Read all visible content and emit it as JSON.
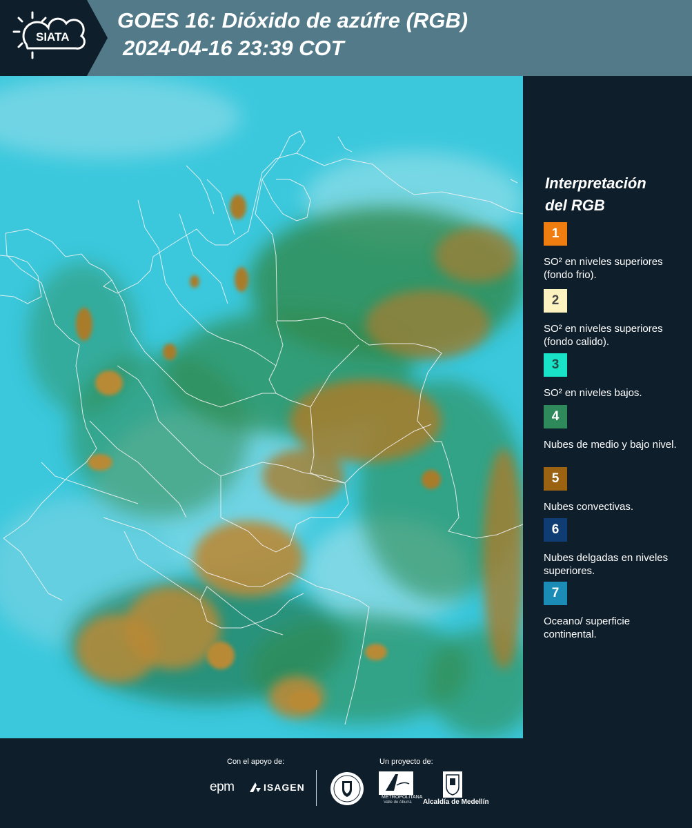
{
  "header": {
    "logo_text": "SIATA",
    "title_line1": "GOES 16: Dióxido de azúfre (RGB)",
    "title_line2": "2024-04-16 23:39 COT"
  },
  "legend": {
    "title_line1": "Interpretación",
    "title_line2": "del RGB",
    "items": [
      {
        "number": "1",
        "color": "#f07d0f",
        "text_color": "#ffffff",
        "text": "SO² en niveles superiores (fondo frio)."
      },
      {
        "number": "2",
        "color": "#fdf3c0",
        "text_color": "#444444",
        "text": "SO² en niveles superiores (fondo calido)."
      },
      {
        "number": "3",
        "color": "#18e3c6",
        "text_color": "#1f4e4a",
        "text": "SO² en niveles bajos."
      },
      {
        "number": "4",
        "color": "#2f8a5b",
        "text_color": "#ffffff",
        "text": "Nubes de medio y bajo nivel."
      },
      {
        "number": "5",
        "color": "#9a6211",
        "text_color": "#ffffff",
        "text": "Nubes convectivas."
      },
      {
        "number": "6",
        "color": "#103c74",
        "text_color": "#ffffff",
        "text": "Nubes delgadas en niveles superiores."
      },
      {
        "number": "7",
        "color": "#1b8cb5",
        "text_color": "#ffffff",
        "text": "Oceano/ superficie continental."
      }
    ]
  },
  "footer": {
    "support_label": "Con el apoyo de:",
    "project_label": "Un proyecto de:",
    "sponsors": [
      "epm",
      "ISAGEN"
    ],
    "partners": [
      "Área Metropolitana Valle de Aburrá",
      "Alcaldía de Medellín"
    ],
    "area_text_1": "METROPOLITANA",
    "area_text_2": "Valle de Aburrá",
    "alcaldia_text": "Alcaldía de Medellín"
  },
  "map": {
    "colors": {
      "ocean": "#3bc8dd",
      "haze": "#7ed8e6",
      "vegetation": "#2f8a4e",
      "deep_green": "#1f6e3c",
      "convective": "#a97c2c",
      "convective_light": "#b98a36",
      "border": "#f2f2f2"
    }
  }
}
